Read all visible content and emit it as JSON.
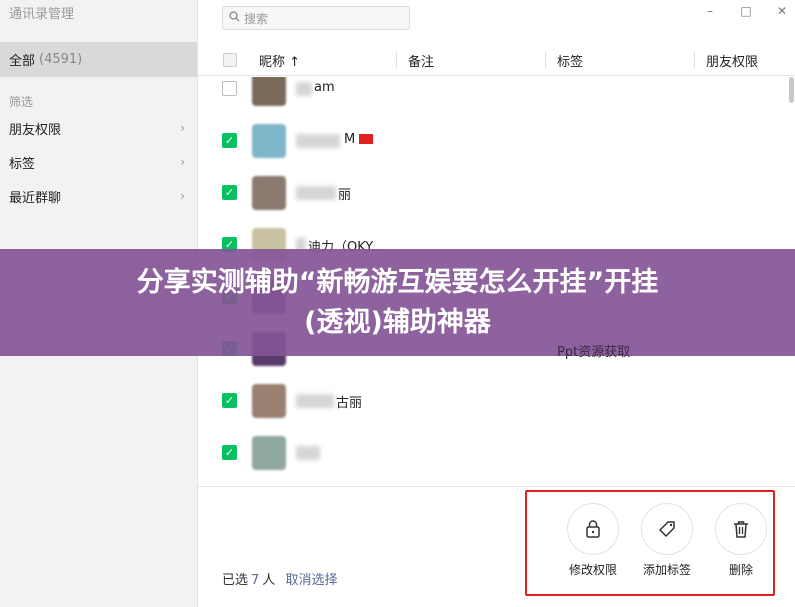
{
  "sidebar": {
    "title": "通讯录管理",
    "all_label": "全部",
    "all_count": "(4591)",
    "filter_label": "筛选",
    "items": [
      {
        "label": "朋友权限"
      },
      {
        "label": "标签"
      },
      {
        "label": "最近群聊"
      }
    ]
  },
  "search": {
    "placeholder": "搜索"
  },
  "window_controls": {
    "minimize": "–",
    "maximize": "□",
    "close": "✕"
  },
  "table": {
    "columns": [
      "昵称 ↑",
      "备注",
      "标签",
      "朋友权限"
    ],
    "rows": [
      {
        "checked": false,
        "nickname": "am",
        "avatar_color": "#7a6a5a"
      },
      {
        "checked": true,
        "nickname": "M",
        "flag": true,
        "avatar_color": "#7fb6c9"
      },
      {
        "checked": true,
        "nickname": "丽",
        "avatar_color": "#8a7a70"
      },
      {
        "checked": true,
        "nickname": "迪力（OKY...",
        "avatar_color": "#c9c2a0"
      },
      {
        "checked": true,
        "nickname": "",
        "avatar_color": "#6a4a7a"
      },
      {
        "checked": true,
        "nickname": "",
        "avatar_color": "#5a3a6a"
      },
      {
        "checked": true,
        "nickname": "古丽",
        "avatar_color": "#9a8070"
      },
      {
        "checked": true,
        "nickname": "",
        "avatar_color": "#8fa8a0"
      }
    ],
    "overlay_tag": "Ppt资源获取"
  },
  "footer": {
    "selected_prefix": "已选",
    "selected_count": "7",
    "selected_suffix": "人",
    "cancel_label": "取消选择",
    "actions": [
      {
        "label": "修改权限",
        "icon": "lock-icon"
      },
      {
        "label": "添加标签",
        "icon": "tag-icon"
      },
      {
        "label": "删除",
        "icon": "trash-icon"
      }
    ]
  },
  "banner": {
    "line1": "分享实测辅助“新畅游互娱要怎么开挂”开挂",
    "line2": "(透视)辅助神器"
  },
  "colors": {
    "accent_green": "#07c160",
    "link_blue": "#576b95",
    "highlight_red": "#e02020",
    "banner_purple": "#845596"
  }
}
